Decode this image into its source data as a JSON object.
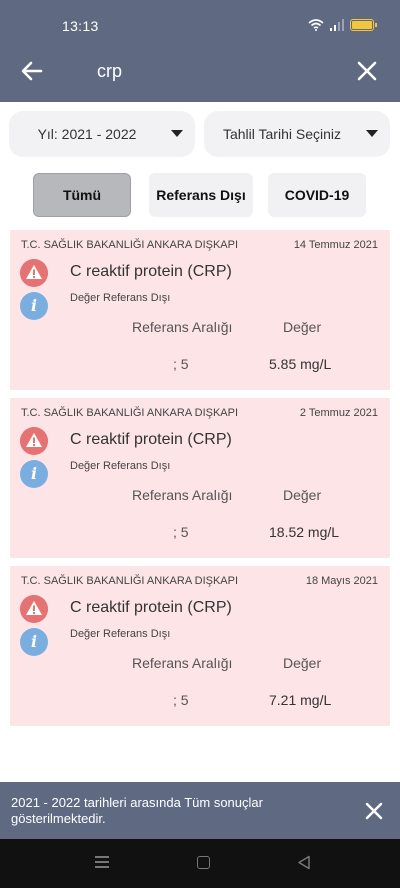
{
  "status_bar": {
    "time": "13:13"
  },
  "app_bar": {
    "search_query": "crp"
  },
  "filters": {
    "year": "Yıl: 2021 - 2022",
    "date_placeholder": "Tahlil Tarihi Seçiniz",
    "chips": [
      "Tümü",
      "Referans Dışı",
      "COVID-19"
    ]
  },
  "results_table": {
    "ref_header": "Referans Aralığı",
    "value_header": "Değer"
  },
  "results": [
    {
      "institution": "T.C. SAĞLIK BAKANLIĞI ANKARA DIŞKAPI",
      "date": "14 Temmuz 2021",
      "test": "C reaktif protein (CRP)",
      "status": "Değer Referans Dışı",
      "ref_range": "; 5",
      "value": "5.85 mg/L"
    },
    {
      "institution": "T.C. SAĞLIK BAKANLIĞI ANKARA DIŞKAPI",
      "date": "2 Temmuz 2021",
      "test": "C reaktif protein (CRP)",
      "status": "Değer Referans Dışı",
      "ref_range": "; 5",
      "value": "18.52 mg/L"
    },
    {
      "institution": "T.C. SAĞLIK BAKANLIĞI ANKARA DIŞKAPI",
      "date": "18 Mayıs 2021",
      "test": "C reaktif protein (CRP)",
      "status": "Değer Referans Dışı",
      "ref_range": "; 5",
      "value": "7.21 mg/L"
    }
  ],
  "snackbar": {
    "message": "2021 - 2022 tarihleri arasında Tüm sonuçlar gösterilmektedir."
  },
  "colors": {
    "app_bar": "#5f6a82",
    "card_bg": "#fde4e6",
    "warning": "#e57373",
    "info": "#7aaee0",
    "battery": "#f3c63c"
  },
  "icons": [
    "back-arrow-icon",
    "close-icon",
    "wifi-icon",
    "signal-icon",
    "battery-icon",
    "caret-down-icon",
    "warning-icon",
    "info-icon",
    "nav-menu-icon",
    "nav-home-icon",
    "nav-back-icon"
  ]
}
